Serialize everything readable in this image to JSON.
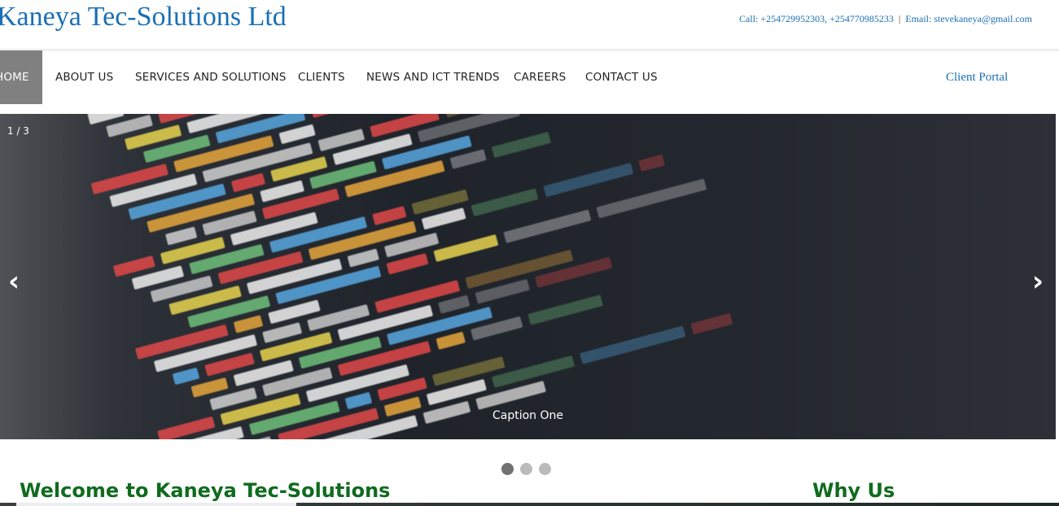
{
  "header": {
    "brand": "Kaneya Tec-Solutions Ltd",
    "call": "Call: +254729952303, +254770985233",
    "separator": "|",
    "email": "Email: stevekaneya@gmail.com"
  },
  "nav": {
    "items": [
      "HOME",
      "ABOUT US",
      "SERVICES AND SOLUTIONS",
      "CLIENTS",
      "NEWS AND ICT TRENDS",
      "CAREERS",
      "CONTACT US"
    ],
    "active": "HOME",
    "portal": "Client Portal"
  },
  "slider": {
    "counter": "1 / 3",
    "prev_icon": "‹",
    "next_icon": "›",
    "caption": "Caption One",
    "image": "code-editor-screenshot",
    "dots_total": 3,
    "dots_active": 1
  },
  "sections": {
    "welcome": "Welcome to Kaneya Tec-Solutions",
    "why": "Why Us"
  },
  "colors": {
    "brand_blue": "#1a6fb5",
    "heading_green": "#0f6b1e",
    "nav_active_bg": "#808080"
  }
}
